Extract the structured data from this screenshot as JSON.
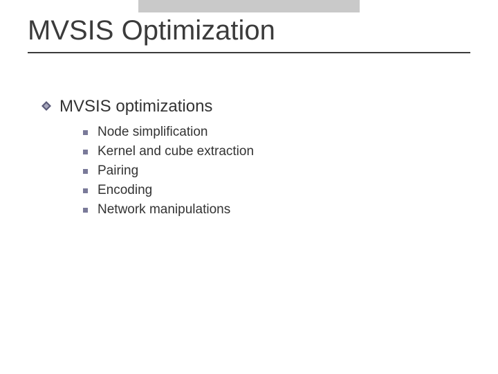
{
  "title": "MVSIS Optimization",
  "section": {
    "heading": "MVSIS optimizations",
    "items": [
      "Node simplification",
      "Kernel and cube extraction",
      "Pairing",
      "Encoding",
      "Network manipulations"
    ]
  },
  "colors": {
    "topbar": "#c9c9c9",
    "rule": "#3b3b3b",
    "bullet_square": "#7a7a99",
    "diamond_outer": "#5a5a78",
    "diamond_inner": "#8a8aa8"
  }
}
